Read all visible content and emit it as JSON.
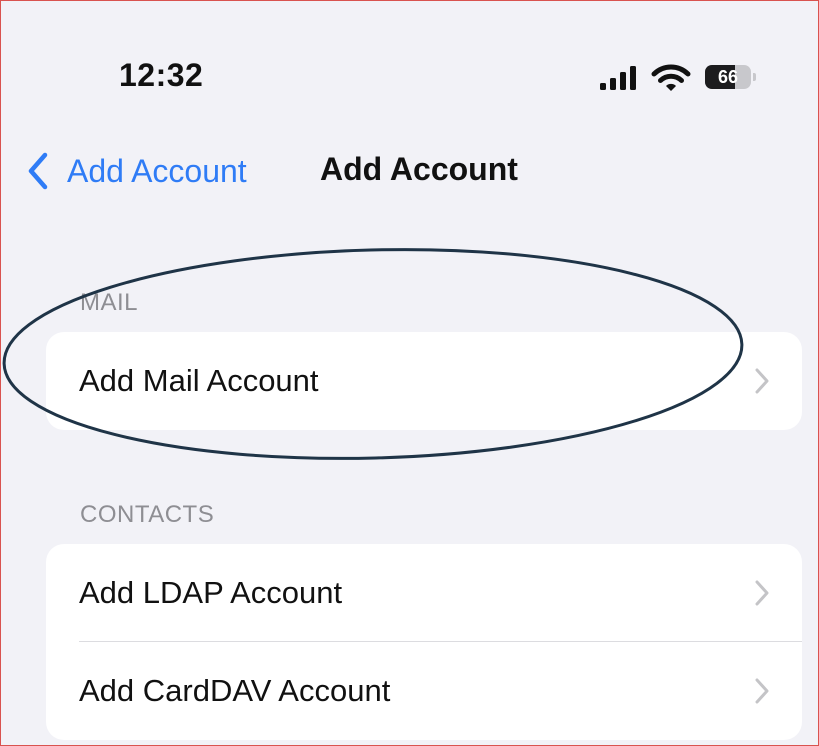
{
  "status_bar": {
    "time": "12:32",
    "battery_label": "66",
    "battery_level_percent": 66,
    "icons": [
      "signal-icon",
      "wifi-icon",
      "battery-icon"
    ]
  },
  "nav": {
    "back_label": "Add Account",
    "title": "Add Account",
    "back_icon": "chevron-left-icon"
  },
  "sections": {
    "mail": {
      "header": "MAIL",
      "items": [
        {
          "label": "Add Mail Account"
        }
      ]
    },
    "contacts": {
      "header": "CONTACTS",
      "items": [
        {
          "label": "Add LDAP Account"
        },
        {
          "label": "Add CardDAV Account"
        }
      ]
    }
  },
  "colors": {
    "accent": "#2f7cf6",
    "background": "#f2f2f7",
    "cell": "#ffffff",
    "secondary_text": "#8e8e93",
    "annotation": "#1f3447",
    "frame_border": "#d9534f"
  },
  "annotation": {
    "shape": "ellipse",
    "highlights": "Add Mail Account"
  }
}
